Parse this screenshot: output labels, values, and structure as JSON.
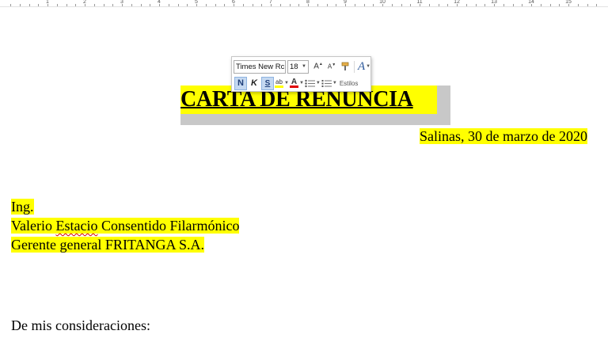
{
  "ruler": {
    "numbers": [
      "1",
      "2",
      "3",
      "4",
      "5",
      "6",
      "7",
      "8",
      "9",
      "10",
      "11",
      "12",
      "13",
      "14",
      "15"
    ]
  },
  "mini_toolbar": {
    "font_name": "Times New Rc",
    "font_size": "18",
    "grow_font_glyph": "A",
    "shrink_font_glyph": "A",
    "styles_glyph": "A",
    "bold_label": "N",
    "italic_label": "K",
    "underline_label": "S",
    "highlight_glyph": "ab",
    "font_color_glyph": "A",
    "styles_label": "Estilos"
  },
  "document": {
    "title": "CARTA DE RENUNCIA",
    "date_line": "Salinas, 30 de marzo de 2020",
    "recipient_title": "Ing.",
    "recipient_name_first": "Valerio ",
    "recipient_name_misspelled": "Estacio",
    "recipient_name_rest": " Consentido Filarmónico",
    "recipient_role": "Gerente general FRITANGA S.A.",
    "greeting": "De mis consideraciones:"
  },
  "colors": {
    "highlight": "#ffff00",
    "selection": "#c8c8c8",
    "spellcheck": "#d20000"
  }
}
